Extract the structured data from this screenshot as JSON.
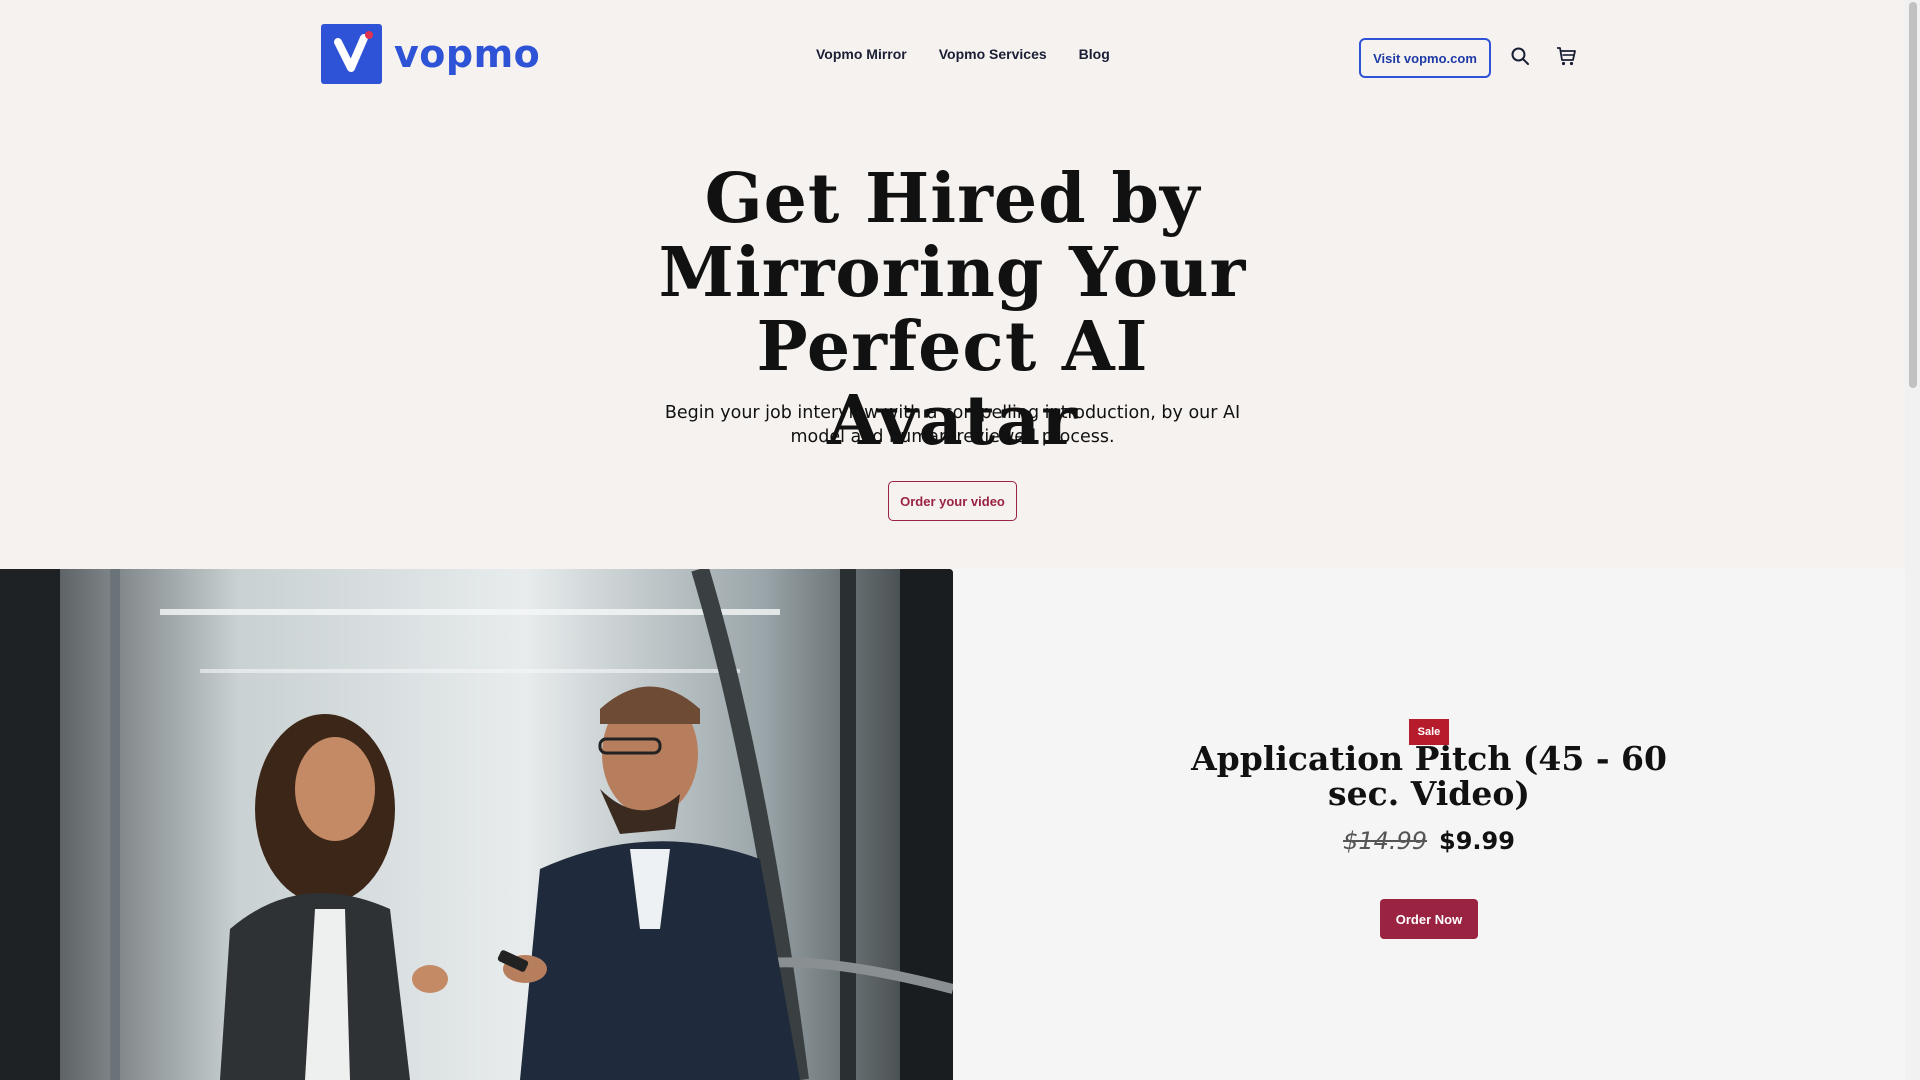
{
  "header": {
    "logo_text": "vopmo",
    "brand_color": "#2f53d6",
    "nav": [
      {
        "label": "Vopmo Mirror"
      },
      {
        "label": "Vopmo Services"
      },
      {
        "label": "Blog"
      }
    ],
    "visit_label": "Visit vopmo.com",
    "icons": [
      "search-icon",
      "cart-icon"
    ]
  },
  "hero": {
    "title_lines": [
      "Get Hired by",
      "Mirroring Your",
      "Perfect AI Avatar"
    ],
    "subtitle": "Begin your job interview with a compelling introduction, by our AI model and human-reviewed process.",
    "cta_label": "Order your video",
    "accent_color": "#9b2342"
  },
  "product": {
    "badge": "Sale",
    "title": "Application Pitch (45 - 60 sec. Video)",
    "old_price": "$14.99",
    "new_price": "$9.99",
    "cta_label": "Order Now",
    "badge_color": "#b71c2d"
  }
}
